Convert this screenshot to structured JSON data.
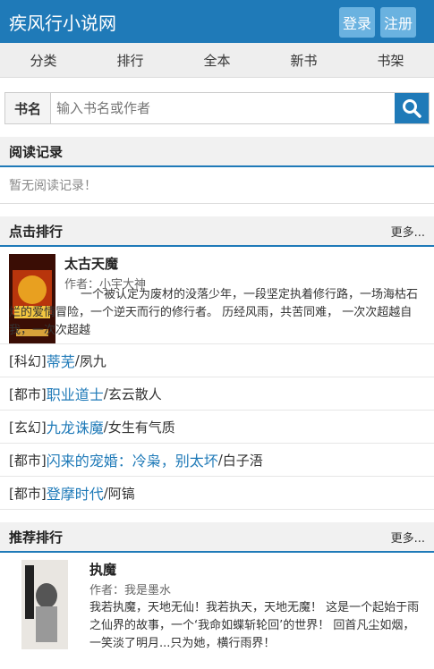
{
  "header": {
    "site_title": "疾风行小说网",
    "login": "登录",
    "register": "注册"
  },
  "nav": [
    "分类",
    "排行",
    "全本",
    "新书",
    "书架"
  ],
  "search": {
    "label": "书名",
    "placeholder": "输入书名或作者"
  },
  "reading": {
    "title": "阅读记录",
    "empty": "暂无阅读记录！"
  },
  "click_rank": {
    "title": "点击排行",
    "more": "更多...",
    "featured": {
      "title": "太古天魔",
      "author": "作者：小宇大神",
      "desc": "一个被认定为废材的没落少年，一段坚定执着修行路，一场海枯石烂的爱情冒险，一个逆天而行的修行者。 历经风雨，共苦同难， 一次次超越自我，一次次超越"
    },
    "items": [
      {
        "cat": "[科幻]",
        "book": "蒂芜",
        "author": "夙九"
      },
      {
        "cat": "[都市]",
        "book": "职业道士",
        "author": "玄云散人"
      },
      {
        "cat": "[玄幻]",
        "book": "九龙诛魔",
        "author": "女生有气质"
      },
      {
        "cat": "[都市]",
        "book": "闪来的宠婚：冷枭，别太坏",
        "author": "白子浯"
      },
      {
        "cat": "[都市]",
        "book": "登摩时代",
        "author": "阿镐"
      }
    ]
  },
  "recommend_rank": {
    "title": "推荐排行",
    "more": "更多...",
    "featured": {
      "title": "执魔",
      "author": "作者：我是墨水",
      "desc": "我若执魔，天地无仙！我若执天，天地无魔！ 这是一个起始于雨之仙界的故事，一个‘我命如蝶斩轮回’的世界！ 回首凡尘如烟，一笑淡了明月...只为她，横行雨界！"
    }
  }
}
